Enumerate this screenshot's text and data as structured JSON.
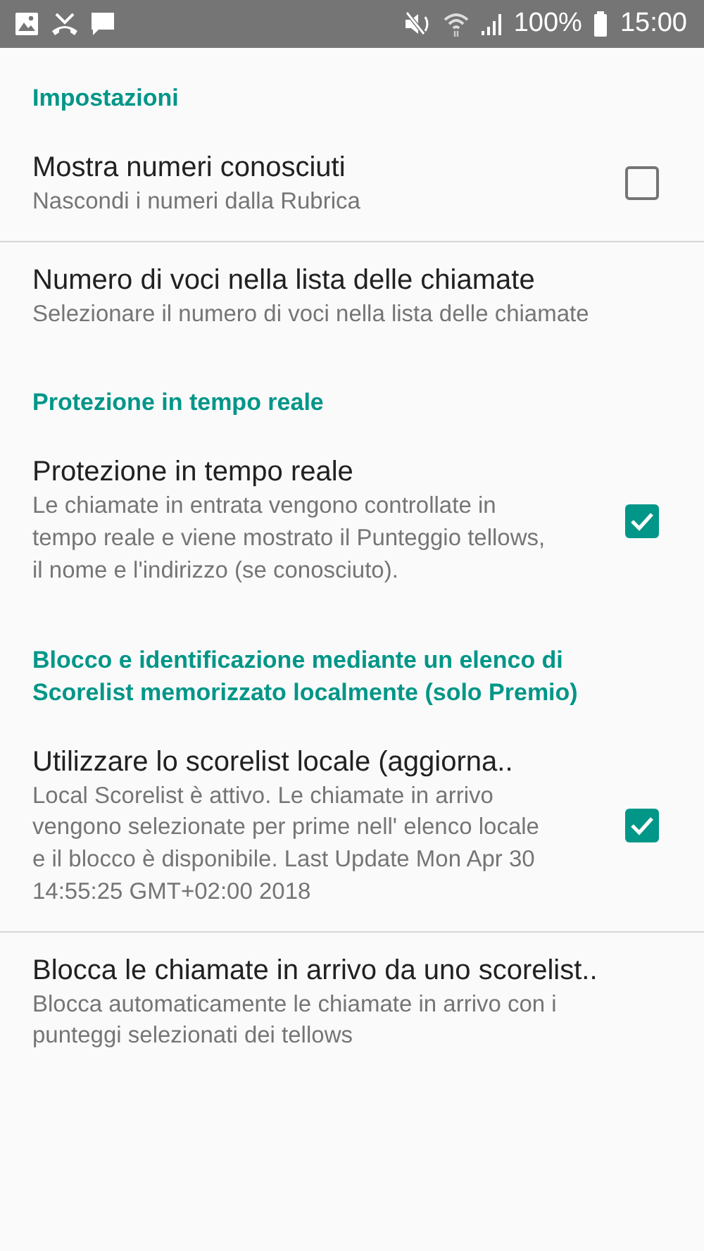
{
  "status_bar": {
    "battery": "100%",
    "time": "15:00"
  },
  "categories": [
    {
      "header": "Impostazioni",
      "items": [
        {
          "kind": "checkbox",
          "title": "Mostra numeri conosciuti",
          "summary": "Nascondi i numeri dalla Rubrica",
          "checked": false
        },
        {
          "kind": "plain",
          "title": "Numero di voci nella lista delle chiamate",
          "summary": "Selezionare il numero di voci nella lista delle chiamate"
        }
      ]
    },
    {
      "header": "Protezione in tempo reale",
      "items": [
        {
          "kind": "checkbox",
          "title": "Protezione in tempo reale",
          "summary": "Le chiamate in entrata vengono controllate in tempo reale e viene mostrato il Punteggio tellows, il nome e l'indirizzo (se conosciuto).",
          "checked": true
        }
      ]
    },
    {
      "header": "Blocco e identificazione mediante un elenco di Scorelist memorizzato localmente (solo Premio)",
      "items": [
        {
          "kind": "checkbox",
          "title": "Utilizzare lo scorelist locale (aggiorna..",
          "summary": "Local Scorelist è attivo. Le chiamate in arrivo vengono selezionate per prime nell' elenco locale e il blocco è disponibile. Last Update Mon Apr 30 14:55:25 GMT+02:00 2018",
          "checked": true
        },
        {
          "kind": "plain",
          "title": "Blocca le chiamate in arrivo da uno scorelist..",
          "summary": "Blocca automaticamente le chiamate in arrivo con i punteggi selezionati dei tellows"
        }
      ]
    }
  ]
}
